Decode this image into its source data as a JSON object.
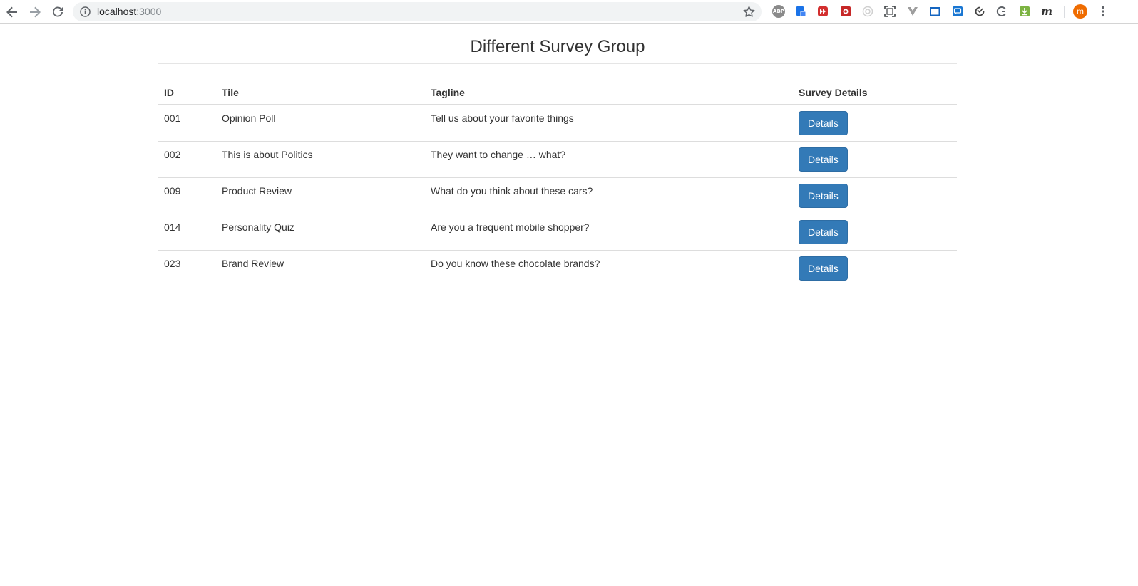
{
  "browser": {
    "url_host": "localhost",
    "url_port": ":3000",
    "avatar_letter": "m",
    "extensions": [
      {
        "icon": "adblock-plus-icon",
        "label": "ABP",
        "color": "#8a8a8a"
      },
      {
        "icon": "docs-extension-icon",
        "label": "",
        "color": "#1a73e8"
      },
      {
        "icon": "fast-forward-extension-icon",
        "label": "",
        "color": "#d32f2f"
      },
      {
        "icon": "red-extension-icon",
        "label": "",
        "color": "#c62828"
      },
      {
        "icon": "circle-extension-icon",
        "label": "",
        "color": "#e0e0e0"
      },
      {
        "icon": "screenshot-frame-icon",
        "label": "",
        "color": "#5f6368"
      },
      {
        "icon": "vue-devtools-icon",
        "label": "",
        "color": "#9e9e9e"
      },
      {
        "icon": "window-extension-icon",
        "label": "",
        "color": "#1565c0"
      },
      {
        "icon": "chat-extension-icon",
        "label": "",
        "color": "#1976d2"
      },
      {
        "icon": "sync-extension-icon",
        "label": "",
        "color": "#424242"
      },
      {
        "icon": "grammarly-icon",
        "label": "",
        "color": "#5f6368"
      },
      {
        "icon": "download-extension-icon",
        "label": "",
        "color": "#8bc34a"
      },
      {
        "icon": "m-extension-icon",
        "label": "m",
        "color": "#ffffff"
      }
    ]
  },
  "page": {
    "title": "Different Survey Group"
  },
  "table": {
    "headers": [
      "ID",
      "Tile",
      "Tagline",
      "Survey Details"
    ],
    "button_label": "Details",
    "rows": [
      {
        "id": "001",
        "title": "Opinion Poll",
        "tagline": "Tell us about your favorite things"
      },
      {
        "id": "002",
        "title": "This is about Politics",
        "tagline": "They want to change … what?"
      },
      {
        "id": "009",
        "title": "Product Review",
        "tagline": "What do you think about these cars?"
      },
      {
        "id": "014",
        "title": "Personality Quiz",
        "tagline": "Are you a frequent mobile shopper?"
      },
      {
        "id": "023",
        "title": "Brand Review",
        "tagline": "Do you know these chocolate brands?"
      }
    ]
  },
  "colors": {
    "primary_button": "#337ab7",
    "text": "#333333",
    "avatar": "#ef6c00"
  }
}
